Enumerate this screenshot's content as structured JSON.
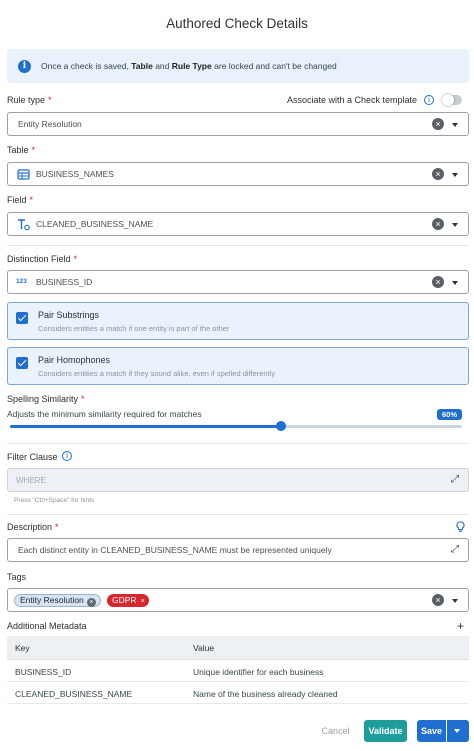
{
  "dialog": {
    "title": "Authored Check Details"
  },
  "info_banner": {
    "prefix": "Once a check is saved, ",
    "bold1": "Table",
    "mid": " and ",
    "bold2": "Rule Type",
    "suffix": " are locked and can't be changed"
  },
  "rule_type": {
    "label": "Rule type",
    "required": "*",
    "value": "Entity Resolution"
  },
  "check_template": {
    "label": "Associate with a Check template",
    "enabled": false
  },
  "table": {
    "label": "Table",
    "required": "*",
    "value": "BUSINESS_NAMES"
  },
  "field": {
    "label": "Field",
    "required": "*",
    "value": "CLEANED_BUSINESS_NAME"
  },
  "distinction_field": {
    "label": "Distinction Field",
    "required": "*",
    "value": "BUSINESS_ID",
    "type_badge": "123"
  },
  "pair_substrings": {
    "title": "Pair Substrings",
    "description": "Considers entities a match if one entity is part of the other",
    "checked": true
  },
  "pair_homophones": {
    "title": "Pair Homophones",
    "description": "Considers entities a match if they sound alike, even if spelled differently",
    "checked": true
  },
  "spelling_similarity": {
    "label": "Spelling Similarity",
    "required": "*",
    "description": "Adjusts the minimum similarity required for matches",
    "value_label": "60%",
    "value": 0.6
  },
  "filter_clause": {
    "label": "Filter Clause",
    "placeholder": "WHERE",
    "hint": "Press \"Ctrl+Space\" for hints"
  },
  "description": {
    "label": "Description",
    "required": "*",
    "value": "Each distinct entity in CLEANED_BUSINESS_NAME must be represented uniquely"
  },
  "tags": {
    "label": "Tags",
    "items": [
      {
        "label": "Entity Resolution",
        "color": "#d6e3f3"
      },
      {
        "label": "GDPR",
        "color": "#d7262f"
      }
    ]
  },
  "metadata": {
    "label": "Additional Metadata",
    "add_icon": "+",
    "columns": [
      "Key",
      "Value"
    ],
    "rows": [
      [
        "BUSINESS_ID",
        "Unique identifier for each business"
      ],
      [
        "CLEANED_BUSINESS_NAME",
        "Name of the business already cleaned"
      ]
    ]
  },
  "footer": {
    "cancel": "Cancel",
    "validate": "Validate",
    "save": "Save"
  },
  "colors": {
    "primary": "#1f6fd1",
    "validate": "#1e9e9b",
    "required": "#d7262f"
  }
}
